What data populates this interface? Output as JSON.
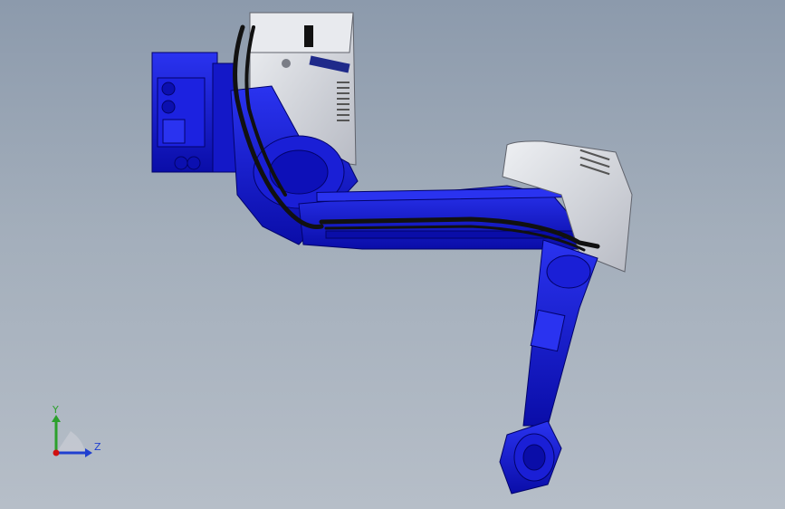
{
  "viewport": {
    "background_top": "#8c9aac",
    "background_bottom": "#b6bec8"
  },
  "model": {
    "name": "industrial-robot-arm",
    "body_color": "#1a1fd6",
    "body_dark": "#06089a",
    "cover_color": "#d4d6dc",
    "cover_dark": "#9a9ca6",
    "cable_color": "#111111"
  },
  "triad": {
    "y_label": "Y",
    "z_label": "Z",
    "y_color": "#2ca02c",
    "z_color": "#1f3fd0",
    "x_color": "#d01010"
  }
}
